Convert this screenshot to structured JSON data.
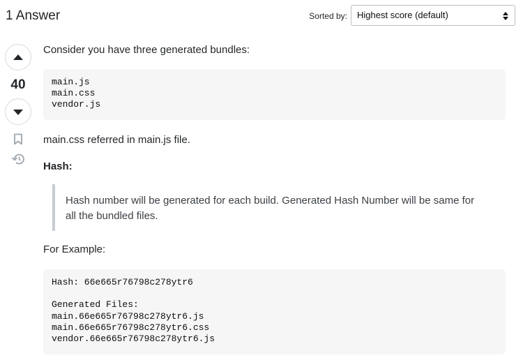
{
  "header": {
    "answers_count": "1 Answer",
    "sorted_label": "Sorted by:",
    "sort_value": "Highest score (default)"
  },
  "votes": {
    "score": "40",
    "up_icon": "caret-up-icon",
    "down_icon": "caret-down-icon",
    "bookmark_icon": "bookmark-icon",
    "history_icon": "history-icon"
  },
  "post": {
    "intro": "Consider you have three generated bundles:",
    "bundles_code": "main.js\nmain.css\nvendor.js",
    "reference": "main.css referred in main.js file.",
    "hash_heading": "Hash:",
    "hash_quote": "Hash number will be generated for each build. Generated Hash Number will be same for all the bundled files.",
    "example_label": "For Example:",
    "example_code": "Hash: 66e665r76798c278ytr6\n\nGenerated Files:\nmain.66e665r76798c278ytr6.js\nmain.66e665r76798c278ytr6.css\nvendor.66e665r76798c278ytr6.js"
  }
}
